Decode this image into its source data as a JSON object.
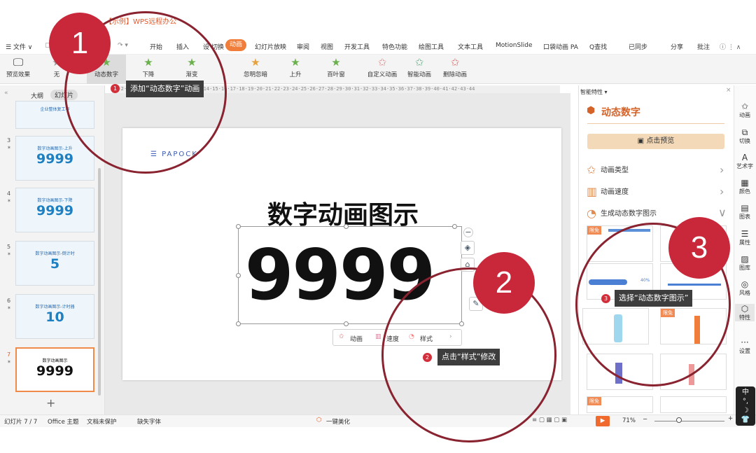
{
  "window": {
    "doc_tab": "【示例】WPS远程办公"
  },
  "menu": {
    "file": "☰ 文件 ∨",
    "items": [
      "开始",
      "插入",
      "设",
      "切换",
      "动画",
      "幻灯片放映",
      "审阅",
      "视图",
      "开发工具",
      "特色功能",
      "绘图工具",
      "文本工具",
      "MotionSlide",
      "口袋动画 PA",
      "Q查找"
    ],
    "active": "动画",
    "right": [
      "已同步",
      "分享",
      "批注"
    ]
  },
  "ribbon": {
    "items": [
      "预览效果",
      "无",
      "动态数字",
      "下降",
      "渐变",
      "忽明忽暗",
      "上升",
      "百叶窗",
      "自定义动画",
      "智能动画",
      "删除动画"
    ]
  },
  "left_panel": {
    "tabs": [
      "大纲",
      "幻灯片"
    ],
    "top_thumb_text": "企业整体复工率",
    "slides": [
      {
        "num": "3",
        "title": "数字动画图示-上升",
        "value": "9999"
      },
      {
        "num": "4",
        "title": "数字动画图示-下降",
        "value": "9999"
      },
      {
        "num": "5",
        "title": "数字动画图示-倒计时",
        "value": "5"
      },
      {
        "num": "6",
        "title": "数字动画图示-计时器",
        "value": "10"
      },
      {
        "num": "7",
        "title": "数字动画图示",
        "value": "9999"
      }
    ],
    "add": "+"
  },
  "slide": {
    "logo": "☰ PAPOCK",
    "title": "数字动画图示",
    "number": "9999"
  },
  "floatbar": {
    "anim": "动画",
    "speed": "速度",
    "style": "样式"
  },
  "right_panel": {
    "header": "智能特性 ▾",
    "title": "动态数字",
    "preview": "点击预览",
    "rows": [
      "动画类型",
      "动画速度",
      "生成动态数字图示"
    ],
    "badge": "限免",
    "pct": "40%"
  },
  "far_right": [
    "动画",
    "切换",
    "艺术字",
    "颜色",
    "图表",
    "属性",
    "图库",
    "风格",
    "特性",
    "设置"
  ],
  "status": {
    "slide": "幻灯片 7 / 7",
    "theme": "Office 主题",
    "protect": "文档未保护",
    "font": "缺失字体",
    "beautify": "一键美化",
    "zoom": "71%"
  },
  "callouts": {
    "c1": {
      "num": "1",
      "tip": "添加“动态数字”动画"
    },
    "c2": {
      "num": "2",
      "tip": "点击“样式”修改"
    },
    "c3": {
      "num": "3",
      "tip": "选择“动态数字图示”"
    }
  },
  "ime": [
    "中",
    "°,",
    "☽",
    "👕"
  ],
  "colors": {
    "accent": "#f07e3a",
    "callout": "#c8283a",
    "ring": "#8a2330",
    "blue": "#1e7fc1"
  }
}
